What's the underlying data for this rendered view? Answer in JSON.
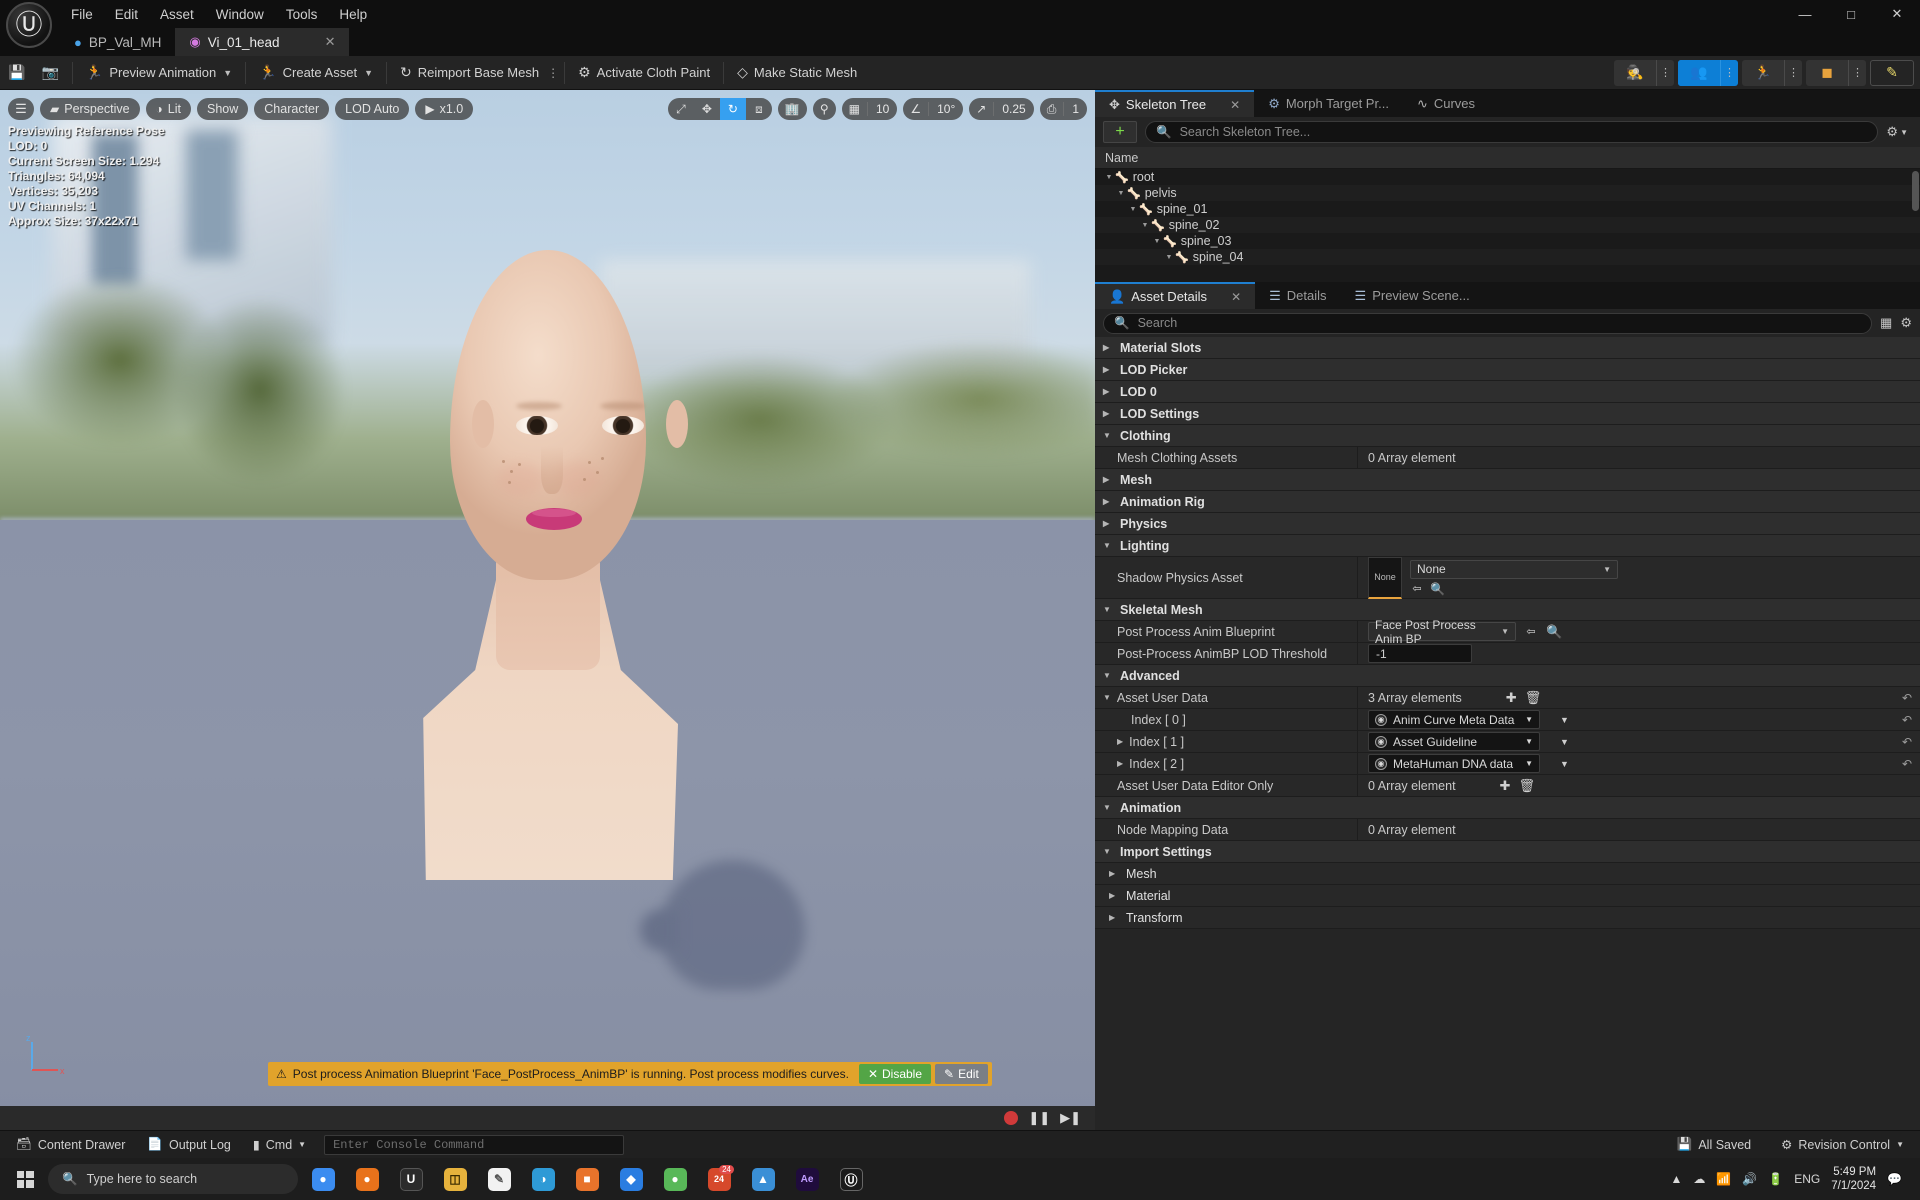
{
  "titlebar": {
    "logo_icon": "unreal-logo",
    "menu": [
      "File",
      "Edit",
      "Asset",
      "Window",
      "Tools",
      "Help"
    ],
    "window_buttons": [
      "minimize",
      "maximize",
      "close"
    ]
  },
  "tabs": [
    {
      "label": "BP_Val_MH",
      "icon": "blueprint-icon",
      "active": false,
      "closable": false
    },
    {
      "label": "Vi_01_head",
      "icon": "skeletal-mesh-icon",
      "active": true,
      "closable": true
    }
  ],
  "toolbar": {
    "save_icon": "save-icon",
    "browse_icon": "browse-content-icon",
    "items": [
      {
        "label": "Preview Animation",
        "icon": "preview-animation-icon",
        "caret": true,
        "dots": false
      },
      {
        "label": "Create Asset",
        "icon": "create-asset-icon",
        "caret": true,
        "dots": false
      },
      {
        "label": "Reimport Base Mesh",
        "icon": "reimport-icon",
        "caret": false,
        "dots": true
      },
      {
        "label": "Activate Cloth Paint",
        "icon": "cloth-paint-icon",
        "caret": false,
        "dots": false
      },
      {
        "label": "Make Static Mesh",
        "icon": "static-mesh-icon",
        "caret": false,
        "dots": false
      }
    ],
    "right_segments": [
      {
        "icon": "skeleton-mode-icon",
        "active": false
      },
      {
        "icon": "mesh-mode-icon",
        "active": true
      },
      {
        "icon": "animation-mode-icon",
        "active": false
      },
      {
        "icon": "physics-mode-icon",
        "active": false
      }
    ],
    "pen_icon": "paint-tool-icon",
    "accent_blue": "#0d7fd6"
  },
  "viewport": {
    "left_pills": [
      {
        "label": "Perspective",
        "icon": "cube-icon"
      },
      {
        "label": "Lit",
        "icon": "lighting-icon"
      },
      {
        "label": "Show",
        "icon": ""
      },
      {
        "label": "Character",
        "icon": ""
      },
      {
        "label": "LOD Auto",
        "icon": ""
      },
      {
        "label": "x1.0",
        "icon": "play-icon"
      }
    ],
    "stats": [
      "Previewing Reference Pose",
      "LOD: 0",
      "Current Screen Size: 1.294",
      "Triangles: 64,094",
      "Vertices: 35,203",
      "UV Channels: 1",
      "Approx Size: 37x22x71"
    ],
    "gizmo_modes": [
      {
        "icon": "select-cursor-icon",
        "active": false
      },
      {
        "icon": "move-gizmo-icon",
        "active": false
      },
      {
        "icon": "rotate-gizmo-icon",
        "active": true
      },
      {
        "icon": "scale-gizmo-icon",
        "active": false
      }
    ],
    "coord_icon": "world-coords-icon",
    "surface_snap_icon": "surface-snap-icon",
    "grid_snap": {
      "icon": "grid-snap-icon",
      "value": "10"
    },
    "angle_snap": {
      "icon": "angle-snap-icon",
      "value": "10°"
    },
    "scale_snap": {
      "icon": "scale-snap-icon",
      "value": "0.25"
    },
    "camera_speed": {
      "icon": "camera-speed-icon",
      "value": "1"
    },
    "axis_labels": {
      "z": "z",
      "x": "x",
      "y": "y"
    },
    "notification": {
      "warn_icon": "warning-icon",
      "text": "Post process Animation Blueprint 'Face_PostProcess_AnimBP' is running. Post process modifies curves.",
      "disable_label": "Disable",
      "disable_icon": "x-icon",
      "edit_label": "Edit",
      "edit_icon": "pencil-icon",
      "bg_color": "#e1a32b",
      "disable_color": "#53a546"
    },
    "transport": {
      "record_icon": "record-icon",
      "pause_icon": "pause-icon",
      "step_icon": "step-forward-icon"
    }
  },
  "skeleton_panel": {
    "tabs": [
      {
        "label": "Skeleton Tree",
        "icon": "skeleton-tree-icon",
        "active": true,
        "closable": true
      },
      {
        "label": "Morph Target Pr...",
        "icon": "morph-target-icon",
        "active": false,
        "closable": false
      },
      {
        "label": "Curves",
        "icon": "curves-icon",
        "active": false,
        "closable": false
      }
    ],
    "add_button_icon": "plus-icon",
    "search_placeholder": "Search Skeleton Tree...",
    "search_icon": "search-icon",
    "settings_icon": "gear-icon",
    "column_header": "Name",
    "bones": [
      {
        "name": "root",
        "depth": 0
      },
      {
        "name": "pelvis",
        "depth": 1
      },
      {
        "name": "spine_01",
        "depth": 2
      },
      {
        "name": "spine_02",
        "depth": 3
      },
      {
        "name": "spine_03",
        "depth": 4
      },
      {
        "name": "spine_04",
        "depth": 5
      }
    ]
  },
  "details_panel": {
    "tabs": [
      {
        "label": "Asset Details",
        "icon": "asset-details-icon",
        "active": true,
        "closable": true
      },
      {
        "label": "Details",
        "icon": "details-icon",
        "active": false,
        "closable": false
      },
      {
        "label": "Preview Scene...",
        "icon": "preview-scene-icon",
        "active": false,
        "closable": false
      }
    ],
    "search_placeholder": "Search",
    "search_icon": "search-icon",
    "grid_view_icon": "grid-view-icon",
    "settings_icon": "settings-icon",
    "sections": [
      {
        "kind": "category",
        "label": "Material Slots",
        "expanded": false
      },
      {
        "kind": "category",
        "label": "LOD Picker",
        "expanded": false
      },
      {
        "kind": "category",
        "label": "LOD 0",
        "expanded": false
      },
      {
        "kind": "category",
        "label": "LOD Settings",
        "expanded": false
      },
      {
        "kind": "category",
        "label": "Clothing",
        "expanded": true
      },
      {
        "kind": "prop",
        "label": "Mesh Clothing Assets",
        "value": "0 Array element",
        "indent": 1
      },
      {
        "kind": "category",
        "label": "Mesh",
        "expanded": false
      },
      {
        "kind": "category",
        "label": "Animation Rig",
        "expanded": false
      },
      {
        "kind": "category",
        "label": "Physics",
        "expanded": false
      },
      {
        "kind": "category",
        "label": "Lighting",
        "expanded": true
      },
      {
        "kind": "asset-prop",
        "label": "Shadow Physics Asset",
        "thumb": "None",
        "combo": "None",
        "indent": 1
      },
      {
        "kind": "category",
        "label": "Skeletal Mesh",
        "expanded": true
      },
      {
        "kind": "combo-prop",
        "label": "Post Process Anim Blueprint",
        "value": "Face Post Process Anim BP",
        "indent": 1
      },
      {
        "kind": "text-prop",
        "label": "Post-Process AnimBP LOD Threshold",
        "value": "-1",
        "indent": 1
      },
      {
        "kind": "category",
        "label": "Advanced",
        "expanded": true
      },
      {
        "kind": "array-prop",
        "label": "Asset User Data",
        "value": "3 Array elements",
        "indent": 1
      },
      {
        "kind": "index-prop",
        "label": "Index [ 0 ]",
        "value": "Anim Curve Meta Data",
        "indent": 2,
        "twisty": false
      },
      {
        "kind": "index-prop",
        "label": "Index [ 1 ]",
        "value": "Asset Guideline",
        "indent": 2,
        "twisty": true
      },
      {
        "kind": "index-prop",
        "label": "Index [ 2 ]",
        "value": "MetaHuman DNA data",
        "indent": 2,
        "twisty": true
      },
      {
        "kind": "array-prop",
        "label": "Asset User Data Editor Only",
        "value": "0 Array element",
        "indent": 1
      },
      {
        "kind": "category",
        "label": "Animation",
        "expanded": true
      },
      {
        "kind": "prop",
        "label": "Node Mapping Data",
        "value": "0 Array element",
        "indent": 1
      },
      {
        "kind": "category",
        "label": "Import Settings",
        "expanded": true
      },
      {
        "kind": "category",
        "label": "Mesh",
        "expanded": false,
        "sub": true
      },
      {
        "kind": "category",
        "label": "Material",
        "expanded": false,
        "sub": true
      },
      {
        "kind": "category",
        "label": "Transform",
        "expanded": false,
        "sub": true
      }
    ],
    "add_icon": "plus-circle-icon",
    "delete_icon": "trash-icon",
    "revert_icon": "revert-arrow-icon",
    "browse_icon": "browse-icon",
    "use_selected_icon": "use-selected-icon"
  },
  "statusbar": {
    "content_drawer": {
      "label": "Content Drawer",
      "icon": "drawer-icon"
    },
    "output_log": {
      "label": "Output Log",
      "icon": "log-icon"
    },
    "cmd": {
      "label": "Cmd",
      "icon": "cmd-icon",
      "caret": true
    },
    "console_placeholder": "Enter Console Command",
    "all_saved": {
      "label": "All Saved",
      "icon": "saved-icon"
    },
    "revision_control": {
      "label": "Revision Control",
      "icon": "revision-icon",
      "caret": true
    }
  },
  "taskbar": {
    "start_icon": "windows-start-icon",
    "search_placeholder": "Type here to search",
    "search_icon": "search-icon",
    "apps": [
      {
        "name": "chrome-icon",
        "glyph": "●",
        "color": "#3b8cf0",
        "badge": ""
      },
      {
        "name": "firefox-icon",
        "glyph": "●",
        "color": "#e8721b",
        "badge": ""
      },
      {
        "name": "unreal-launcher-icon",
        "glyph": "U",
        "color": "#2b2b2b",
        "badge": ""
      },
      {
        "name": "file-explorer-icon",
        "glyph": "▤",
        "color": "#e6b23c",
        "badge": ""
      },
      {
        "name": "notepad-icon",
        "glyph": "▧",
        "color": "#f2f2f2",
        "badge": ""
      },
      {
        "name": "edge-icon",
        "glyph": "◑",
        "color": "#2e9ad6",
        "badge": ""
      },
      {
        "name": "office-icon",
        "glyph": "■",
        "color": "#e8732b",
        "badge": ""
      },
      {
        "name": "onedrive-icon",
        "glyph": "◆",
        "color": "#2a7de1",
        "badge": ""
      },
      {
        "name": "chat-icon",
        "glyph": "●",
        "color": "#58b858",
        "badge": ""
      },
      {
        "name": "calendar-icon",
        "glyph": "24",
        "color": "#d6492b",
        "badge": "24"
      },
      {
        "name": "store-icon",
        "glyph": "▲",
        "color": "#3a8fd6",
        "badge": ""
      },
      {
        "name": "after-effects-icon",
        "glyph": "Ae",
        "color": "#1f0c3c",
        "badge": ""
      },
      {
        "name": "unreal-editor-icon",
        "glyph": "ⓤ",
        "color": "#1b1b1b",
        "badge": ""
      }
    ],
    "tray": {
      "chevron_icon": "show-hidden-icons",
      "onedrive_icon": "onedrive-tray-icon",
      "network_icon": "network-icon",
      "volume_icon": "volume-icon",
      "battery_icon": "battery-icon",
      "lang": "ENG",
      "time": "5:49 PM",
      "date": "7/1/2024",
      "notify_icon": "notifications-icon"
    }
  }
}
